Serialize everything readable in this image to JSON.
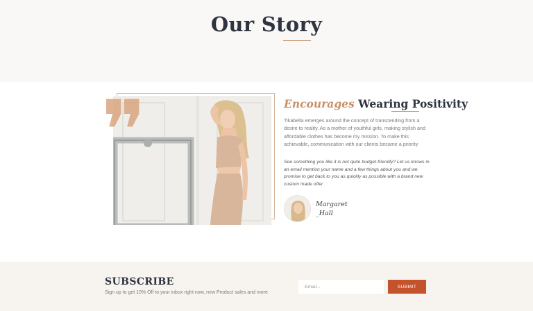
{
  "hero": {
    "title": "Our Story"
  },
  "story": {
    "heading_accent": "Encourages",
    "heading_rest": "Wearing Positivity",
    "body": "Tikabella emerges around the concept of transcending from a desire to reality. As a mother of youthful girls, making stylish and affordable clothes has become my mission. To make this achievable, communication with our clients became a priority",
    "quote": "See something you like it is not quite budget-friendly? Let us knows in an email mention your name and a few things about you and we promise to get back to you as quickly as possible with a brand new custom made offer",
    "author_first": "Margaret",
    "author_last": "_Hall"
  },
  "subscribe": {
    "title": "SUBSCRIBE",
    "text": "Sign up to get 10% Off to your inbox right now, new Product sales and more",
    "email_placeholder": "Email...",
    "submit_label": "SUBMIT"
  },
  "colors": {
    "accent": "#c8916a",
    "button": "#c4522b",
    "heading": "#2e3440"
  }
}
